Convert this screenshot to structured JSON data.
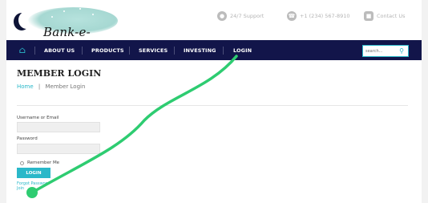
{
  "brand": {
    "name": "Bank-e-Moon"
  },
  "contact": [
    {
      "icon": "chat-bubble-icon",
      "label": "24/7 Support"
    },
    {
      "icon": "phone-icon",
      "label": "+1 (234) 567-8910"
    },
    {
      "icon": "message-icon",
      "label": "Contact Us"
    }
  ],
  "nav": {
    "items": [
      "ABOUT US",
      "PRODUCTS",
      "SERVICES",
      "INVESTING",
      "LOGIN"
    ],
    "search_placeholder": "search..."
  },
  "main": {
    "title": "MEMBER LOGIN",
    "breadcrumb": {
      "home": "Home",
      "separator": "|",
      "current": "Member Login"
    }
  },
  "form": {
    "username_label": "Username or Email",
    "username_value": "",
    "password_label": "Password",
    "password_value": "",
    "remember_label": "Remember Me",
    "login_button": "LOGIN",
    "forgot_link": "Forgot Password",
    "join_link": "Join"
  },
  "colors": {
    "nav_bg": "#12154a",
    "accent": "#2ab8c9",
    "annotation_stroke": "#2ecc71"
  }
}
